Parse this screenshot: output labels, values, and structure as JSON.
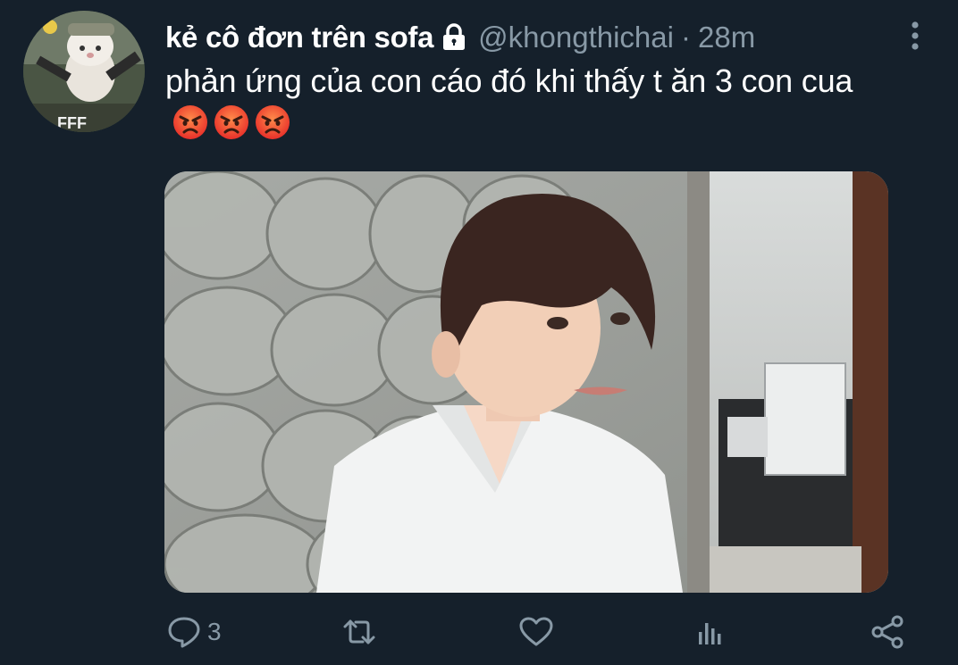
{
  "tweet": {
    "display_name": "kẻ cô đơn trên sofa",
    "handle": "@khongthichai",
    "separator": "·",
    "time": "28m",
    "text": "phản ứng của con cáo đó khi thấy t ăn 3 con cua",
    "emojis": [
      "angry-face",
      "angry-face",
      "angry-face"
    ],
    "avatar_badge_text": "FFF"
  },
  "actions": {
    "reply_count": "3",
    "retweet_count": "",
    "like_count": ""
  },
  "colors": {
    "background": "#15202b",
    "secondary_text": "#8899a6",
    "primary_text": "#ffffff"
  }
}
